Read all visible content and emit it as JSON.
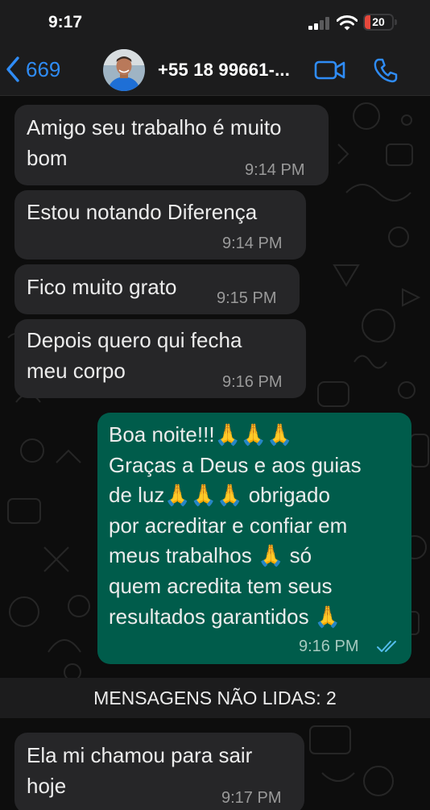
{
  "status_bar": {
    "time": "9:17",
    "battery_level": "20",
    "battery_fraction": 0.2
  },
  "header": {
    "back_count": "669",
    "contact_name": "+55 18 99661-...",
    "back_icon": "chevron-left-icon",
    "video_icon": "video-camera-icon",
    "call_icon": "phone-icon"
  },
  "messages": [
    {
      "direction": "incoming",
      "text": "Amigo seu trabalho é muito\nbom",
      "time": "9:14 PM"
    },
    {
      "direction": "incoming",
      "text": "Estou notando Diferença",
      "time": "9:14 PM"
    },
    {
      "direction": "incoming",
      "text": "Fico muito grato",
      "time": "9:15 PM"
    },
    {
      "direction": "incoming",
      "text": "Depois quero qui fecha\nmeu corpo",
      "time": "9:16 PM"
    },
    {
      "direction": "outgoing",
      "text": "Boa noite!!!🙏🙏🙏\nGraças a Deus e aos guias\nde luz🙏🙏🙏 obrigado\npor acreditar e confiar em\nmeus trabalhos 🙏 só\nquem acredita tem seus\nresultados garantidos 🙏",
      "time": "9:16 PM",
      "status": "read"
    },
    {
      "direction": "incoming",
      "text": "Ela mi chamou para sair\nhoje",
      "time": "9:17 PM"
    }
  ],
  "unread_banner": "MENSAGENS NÃO LIDAS: 2",
  "colors": {
    "accent_blue": "#2f8cf6",
    "incoming_bubble": "#262628",
    "outgoing_bubble": "#005c4b",
    "battery_low": "#e5483c"
  }
}
